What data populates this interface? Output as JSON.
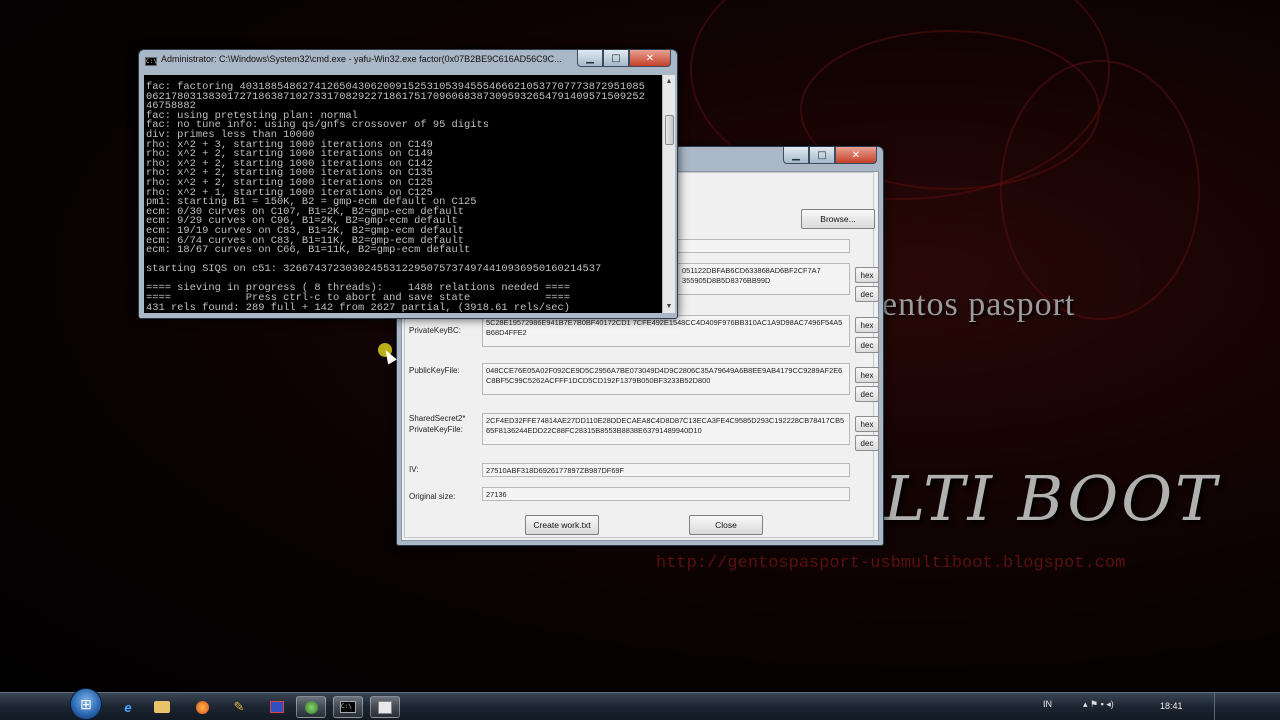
{
  "wallpaper": {
    "brand_text": "entos pasport",
    "logo_text": "LTI BOOT",
    "url_text": "http://gentospasport-usbmultiboot.blogspot.com"
  },
  "cmd_window": {
    "title": "Administrator: C:\\Windows\\System32\\cmd.exe - yafu-Win32.exe  factor(0x07B2BE9C616AD56C9C...",
    "lines": [
      "fac: factoring 40318854862741265043062009152531053945554666210537707773872951085",
      "06217803138301727186387102733170829227186175170960683873095932654791409571509252",
      "46758882",
      "fac: using pretesting plan: normal",
      "fac: no tune info: using qs/gnfs crossover of 95 digits",
      "div: primes less than 10000",
      "rho: x^2 + 3, starting 1000 iterations on C149",
      "rho: x^2 + 2, starting 1000 iterations on C149",
      "rho: x^2 + 2, starting 1000 iterations on C142",
      "rho: x^2 + 2, starting 1000 iterations on C135",
      "rho: x^2 + 2, starting 1000 iterations on C125",
      "rho: x^2 + 1, starting 1000 iterations on C125",
      "pm1: starting B1 = 150K, B2 = gmp-ecm default on C125",
      "ecm: 0/30 curves on C107, B1=2K, B2=gmp-ecm default",
      "ecm: 9/29 curves on C96, B1=2K, B2=gmp-ecm default",
      "ecm: 19/19 curves on C83, B1=2K, B2=gmp-ecm default",
      "ecm: 6/74 curves on C83, B1=11K, B2=gmp-ecm default",
      "ecm: 18/67 curves on C66, B1=11K, B2=gmp-ecm default",
      "",
      "starting SIQS on c51: 326674372303024553122950757374974410936950160214537",
      "",
      "==== sieving in progress ( 8 threads):    1488 relations needed ====",
      "====            Press ctrl-c to abort and save state            ====",
      "431 rels found: 289 full + 142 from 2627 partial, (3918.61 rels/sec)"
    ]
  },
  "dialog": {
    "browse_label": "Browse...",
    "field1_value": "...5C28E19572986E941B7E7B0BF40172CD1...051122DBFAB6CD633868AD6BF2CF7A7 355905D8B5D8376BB99D",
    "field1_value_line1": "051122DBFAB6CD633868AD6BF2CF7A7",
    "field1_value_line2": "355905D8B5D8376BB99D",
    "private_key_bc_label": "PrivateKeyBC:",
    "private_key_bc_value": "5C28E19572986E941B7E7B0BF40172CD1 7CFE492E1548CC4D409F976BB310AC1A9D98AC7496F54A5B68D4FFE2",
    "public_key_file_label": "PublicKeyFile:",
    "public_key_file_value": "048CCE76E05A02F092CE9D5C2956A7BE073049D4D9C2806C35A79649A6B8EE9AB4179CC9289AF2E6C8BF5C99C5262ACFFF1DCD5CD192F1379B050BF3233B52D800",
    "shared_secret_label": "SharedSecret2*\nPrivateKeyFile:",
    "shared_secret_value": "2CF4ED32FFE74814AE27DD110E28DDECAEA8C4D8D87C13ECA3FE4C9585D293C192228CB78417CB565F8136244EDD22C88FC28315B8553B8838E63791489940D10",
    "iv_label": "IV:",
    "iv_value": "27510ABF318D6926177897ZB987DF69F",
    "original_size_label": "Original size:",
    "original_size_value": "27136",
    "hex_label": "hex",
    "dec_label": "dec",
    "create_button": "Create work.txt",
    "close_button": "Close"
  },
  "taskbar": {
    "language": "IN",
    "clock": "18:41"
  }
}
